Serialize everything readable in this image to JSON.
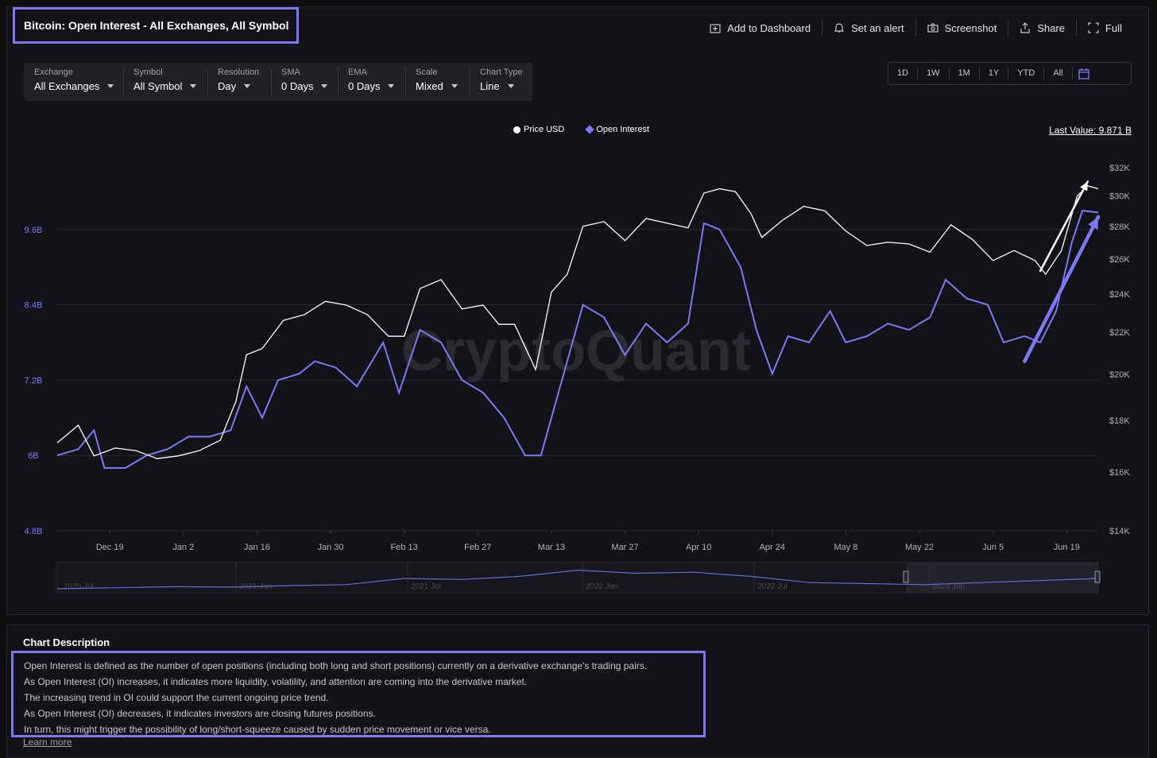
{
  "header": {
    "title": "Bitcoin: Open Interest - All Exchanges, All Symbol",
    "actions": [
      "Add to Dashboard",
      "Set an alert",
      "Screenshot",
      "Share",
      "Full"
    ]
  },
  "controls": [
    {
      "label": "Exchange",
      "value": "All Exchanges"
    },
    {
      "label": "Symbol",
      "value": "All Symbol"
    },
    {
      "label": "Resolution",
      "value": "Day"
    },
    {
      "label": "SMA",
      "value": "0 Days"
    },
    {
      "label": "EMA",
      "value": "0 Days"
    },
    {
      "label": "Scale",
      "value": "Mixed"
    },
    {
      "label": "Chart Type",
      "value": "Line"
    }
  ],
  "ranges": [
    "1D",
    "1W",
    "1M",
    "1Y",
    "YTD",
    "All"
  ],
  "legend": {
    "price": "Price USD",
    "oi": "Open Interest"
  },
  "last_value": "Last Value: 9.871 B",
  "watermark": "CryptoQuant",
  "colors": {
    "price": "#ffffff",
    "oi": "#7c79f6",
    "accent": "#7c79f6",
    "background": "#131317"
  },
  "chart_data": {
    "type": "line",
    "x_range": [
      "2022-12-09",
      "2023-06-25"
    ],
    "x_ticks": [
      "Dec 19",
      "Jan 2",
      "Jan 16",
      "Jan 30",
      "Feb 13",
      "Feb 27",
      "Mar 13",
      "Mar 27",
      "Apr 10",
      "Apr 24",
      "May 8",
      "May 22",
      "Jun 5",
      "Jun 19"
    ],
    "left_axis": {
      "ticks": [
        "4.8B",
        "6B",
        "7.2B",
        "8.4B",
        "9.6B"
      ],
      "tick_values": [
        4.8,
        6.0,
        7.2,
        8.4,
        9.6
      ],
      "range": [
        4.8,
        10.8
      ],
      "unit": "B"
    },
    "right_axis": {
      "ticks": [
        "$14K",
        "$16K",
        "$18K",
        "$20K",
        "$22K",
        "$24K",
        "$26K",
        "$28K",
        "$30K",
        "$32K"
      ],
      "tick_values": [
        14,
        16,
        18,
        20,
        22,
        24,
        26,
        28,
        30,
        32
      ],
      "range": [
        14,
        33
      ],
      "scale": "log",
      "unit": "K USD"
    },
    "series": [
      {
        "name": "Price USD",
        "axis": "right",
        "points": [
          [
            "2022-12-09",
            17.1
          ],
          [
            "2022-12-13",
            17.8
          ],
          [
            "2022-12-16",
            16.6
          ],
          [
            "2022-12-20",
            16.9
          ],
          [
            "2022-12-24",
            16.8
          ],
          [
            "2022-12-28",
            16.5
          ],
          [
            "2023-01-01",
            16.6
          ],
          [
            "2023-01-05",
            16.8
          ],
          [
            "2023-01-09",
            17.2
          ],
          [
            "2023-01-12",
            18.8
          ],
          [
            "2023-01-14",
            20.9
          ],
          [
            "2023-01-17",
            21.2
          ],
          [
            "2023-01-21",
            22.6
          ],
          [
            "2023-01-25",
            22.9
          ],
          [
            "2023-01-29",
            23.6
          ],
          [
            "2023-02-02",
            23.4
          ],
          [
            "2023-02-06",
            22.9
          ],
          [
            "2023-02-10",
            21.8
          ],
          [
            "2023-02-13",
            21.8
          ],
          [
            "2023-02-16",
            24.3
          ],
          [
            "2023-02-20",
            24.8
          ],
          [
            "2023-02-24",
            23.2
          ],
          [
            "2023-02-28",
            23.4
          ],
          [
            "2023-03-03",
            22.4
          ],
          [
            "2023-03-06",
            22.4
          ],
          [
            "2023-03-10",
            20.2
          ],
          [
            "2023-03-13",
            24.1
          ],
          [
            "2023-03-16",
            25.1
          ],
          [
            "2023-03-19",
            28.0
          ],
          [
            "2023-03-23",
            28.3
          ],
          [
            "2023-03-27",
            27.1
          ],
          [
            "2023-03-31",
            28.5
          ],
          [
            "2023-04-04",
            28.2
          ],
          [
            "2023-04-08",
            27.9
          ],
          [
            "2023-04-11",
            30.2
          ],
          [
            "2023-04-14",
            30.5
          ],
          [
            "2023-04-17",
            30.3
          ],
          [
            "2023-04-20",
            28.8
          ],
          [
            "2023-04-22",
            27.3
          ],
          [
            "2023-04-26",
            28.4
          ],
          [
            "2023-04-30",
            29.3
          ],
          [
            "2023-05-04",
            29.0
          ],
          [
            "2023-05-08",
            27.7
          ],
          [
            "2023-05-12",
            26.8
          ],
          [
            "2023-05-16",
            27.0
          ],
          [
            "2023-05-20",
            26.9
          ],
          [
            "2023-05-24",
            26.4
          ],
          [
            "2023-05-28",
            28.1
          ],
          [
            "2023-06-01",
            27.2
          ],
          [
            "2023-06-05",
            25.9
          ],
          [
            "2023-06-09",
            26.5
          ],
          [
            "2023-06-13",
            25.9
          ],
          [
            "2023-06-15",
            25.1
          ],
          [
            "2023-06-18",
            26.5
          ],
          [
            "2023-06-21",
            30.0
          ],
          [
            "2023-06-23",
            30.7
          ],
          [
            "2023-06-25",
            30.5
          ]
        ]
      },
      {
        "name": "Open Interest",
        "axis": "left",
        "points": [
          [
            "2022-12-09",
            6.0
          ],
          [
            "2022-12-13",
            6.1
          ],
          [
            "2022-12-16",
            6.4
          ],
          [
            "2022-12-18",
            5.8
          ],
          [
            "2022-12-22",
            5.8
          ],
          [
            "2022-12-26",
            6.0
          ],
          [
            "2022-12-30",
            6.1
          ],
          [
            "2023-01-03",
            6.3
          ],
          [
            "2023-01-07",
            6.3
          ],
          [
            "2023-01-11",
            6.4
          ],
          [
            "2023-01-14",
            7.1
          ],
          [
            "2023-01-17",
            6.6
          ],
          [
            "2023-01-20",
            7.2
          ],
          [
            "2023-01-24",
            7.3
          ],
          [
            "2023-01-27",
            7.5
          ],
          [
            "2023-01-31",
            7.4
          ],
          [
            "2023-02-04",
            7.1
          ],
          [
            "2023-02-09",
            7.8
          ],
          [
            "2023-02-12",
            7.0
          ],
          [
            "2023-02-16",
            8.0
          ],
          [
            "2023-02-20",
            7.8
          ],
          [
            "2023-02-24",
            7.2
          ],
          [
            "2023-02-28",
            7.0
          ],
          [
            "2023-03-04",
            6.6
          ],
          [
            "2023-03-08",
            6.0
          ],
          [
            "2023-03-11",
            6.0
          ],
          [
            "2023-03-15",
            7.2
          ],
          [
            "2023-03-19",
            8.4
          ],
          [
            "2023-03-23",
            8.2
          ],
          [
            "2023-03-27",
            7.6
          ],
          [
            "2023-03-31",
            8.1
          ],
          [
            "2023-04-04",
            7.8
          ],
          [
            "2023-04-08",
            8.1
          ],
          [
            "2023-04-11",
            9.7
          ],
          [
            "2023-04-14",
            9.6
          ],
          [
            "2023-04-18",
            9.0
          ],
          [
            "2023-04-21",
            8.0
          ],
          [
            "2023-04-24",
            7.3
          ],
          [
            "2023-04-27",
            7.9
          ],
          [
            "2023-05-01",
            7.8
          ],
          [
            "2023-05-05",
            8.3
          ],
          [
            "2023-05-08",
            7.8
          ],
          [
            "2023-05-12",
            7.9
          ],
          [
            "2023-05-16",
            8.1
          ],
          [
            "2023-05-20",
            8.0
          ],
          [
            "2023-05-24",
            8.2
          ],
          [
            "2023-05-27",
            8.8
          ],
          [
            "2023-05-31",
            8.5
          ],
          [
            "2023-06-04",
            8.4
          ],
          [
            "2023-06-07",
            7.8
          ],
          [
            "2023-06-11",
            7.9
          ],
          [
            "2023-06-14",
            7.8
          ],
          [
            "2023-06-17",
            8.3
          ],
          [
            "2023-06-20",
            9.4
          ],
          [
            "2023-06-22",
            9.9
          ],
          [
            "2023-06-25",
            9.871
          ]
        ]
      }
    ],
    "navigator": {
      "labels": [
        "2020 Jul",
        "2021 Jan",
        "2021 Jul",
        "2022 Jan",
        "2022 Jul",
        "2023 Jan"
      ]
    },
    "annotations": [
      {
        "type": "arrow",
        "color": "#ffffff",
        "series": "Price USD",
        "from": [
          "2023-06-14",
          25.3
        ],
        "to": [
          "2023-06-23",
          31.0
        ]
      },
      {
        "type": "arrow",
        "color": "#7c79f6",
        "series": "Open Interest",
        "from": [
          "2023-06-11",
          7.5
        ],
        "to": [
          "2023-06-25",
          9.8
        ]
      }
    ]
  },
  "description": {
    "title": "Chart Description",
    "lines": [
      "Open Interest is defined as the number of open positions (including both long and short positions) currently on a derivative exchange's trading pairs.",
      "As Open Interest (OI) increases, it indicates more liquidity, volatility, and attention are coming into the derivative market.",
      "The increasing trend in OI could support the current ongoing price trend.",
      "As Open Interest (OI) decreases, it indicates investors are closing futures positions.",
      "In turn, this might trigger the possibility of long/short-squeeze caused by sudden price movement or vice versa."
    ],
    "learn_more": "Learn more"
  }
}
